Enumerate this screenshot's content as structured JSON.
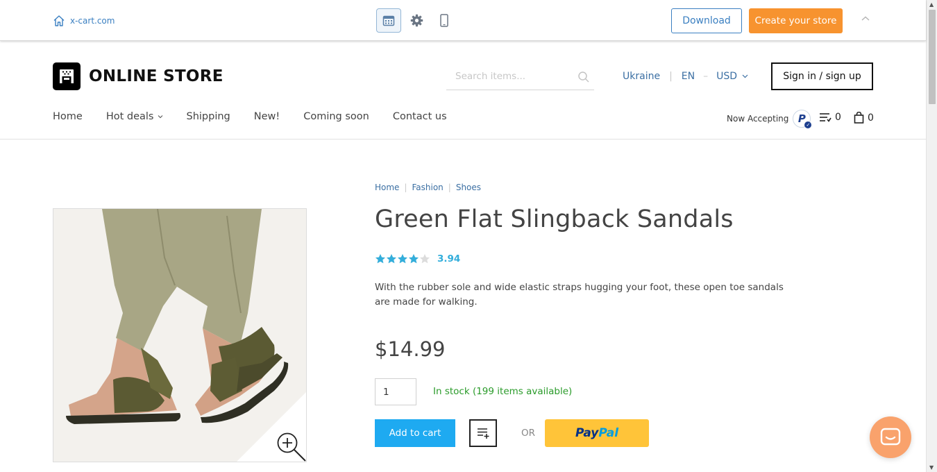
{
  "demo_bar": {
    "home_link": "x-cart.com",
    "download_label": "Download",
    "create_store_label": "Create your store"
  },
  "header": {
    "logo_text": "ONLINE STORE",
    "search_placeholder": "Search items...",
    "country": "Ukraine",
    "language": "EN",
    "currency": "USD",
    "signin_label": "Sign in / sign up",
    "nav": [
      "Home",
      "Hot deals",
      "Shipping",
      "New!",
      "Coming soon",
      "Contact us"
    ],
    "now_accepting": "Now Accepting",
    "compare_count": "0",
    "cart_count": "0"
  },
  "product": {
    "breadcrumb": [
      "Home",
      "Fashion",
      "Shoes"
    ],
    "title": "Green Flat Slingback Sandals",
    "rating": "3.94",
    "rating_stars": 3.94,
    "rating_max": 5,
    "description": "With the rubber sole and wide elastic straps hugging your foot, these open toe sandals are made for walking.",
    "price": "$14.99",
    "quantity": "1",
    "stock_text": "In stock (199 items available)",
    "add_to_cart_label": "Add to cart",
    "or_label": "OR",
    "paypal_pay": "Pay",
    "paypal_pal": "Pal"
  },
  "colors": {
    "accent_blue": "#1eaaf1",
    "orange": "#f7932f",
    "link_blue": "#3b6fa3",
    "stock_green": "#2a9b2a",
    "paypal_yellow": "#ffc439",
    "chat_orange": "#f9a26c"
  },
  "icons": [
    "home-icon",
    "calendar-icon",
    "gear-icon",
    "mobile-icon",
    "chevron-up-icon",
    "search-icon",
    "chevron-down-icon",
    "paypal-icon",
    "compare-list-icon",
    "cart-icon",
    "zoom-icon",
    "add-to-wishlist-icon",
    "chat-icon"
  ]
}
